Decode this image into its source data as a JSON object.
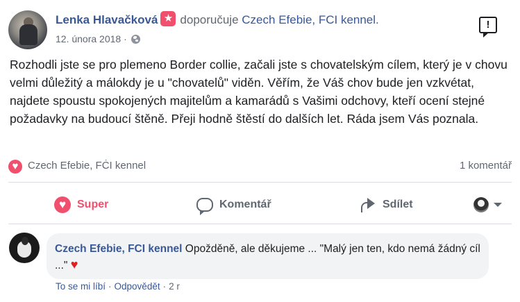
{
  "post": {
    "author": "Lenka Hlavačková",
    "verb": "doporučuje",
    "target": "Czech Efebie, FCI kennel.",
    "date": "12. února 2018",
    "separator": "·",
    "text": "Rozhodli jste se pro plemeno Border collie, začali jste s chovatelským cílem, který je v chovu velmi důležitý a málokdy je u \"chovatelů\" viděn. Věřím, že Váš chov bude jen vzkvétat, najdete spoustu spokojených majitelům a kamarádů s Vašimi odchovy, kteří ocení stejné požadavky na budoucí štěně. Přeji hodně štěstí do dalších let. Ráda jsem Vás poznala."
  },
  "summary": {
    "reactors": "Czech Efebie, FĊI kennel",
    "comment_count": "1 komentář"
  },
  "actions": {
    "super": "Super",
    "comment": "Komentář",
    "share": "Sdílet"
  },
  "comment": {
    "author": "Czech Efebie, FCI kennel",
    "text": "Opožděně, ale děkujeme ... \"Malý jen ten, kdo nemá žádný cíl ...\"",
    "emoji": "♥",
    "like": "To se mi líbí",
    "reply": "Odpovědět",
    "sep": "·",
    "time": "2 r"
  },
  "colors": {
    "link": "#385898",
    "love": "#f0506e",
    "muted": "#606770"
  },
  "icons": [
    "recommend-star-icon",
    "globe-icon",
    "report-icon",
    "love-icon",
    "comment-icon",
    "share-icon",
    "caret-down-icon"
  ]
}
